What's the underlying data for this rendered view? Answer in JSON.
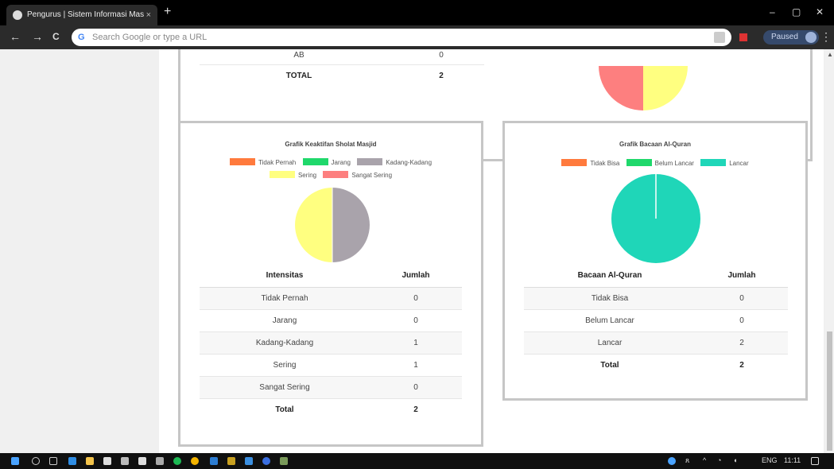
{
  "browser": {
    "tab_title": "Pengurus | Sistem Informasi Mas",
    "tab_close": "×",
    "new_tab": "+",
    "omnibox_placeholder": "Search Google or type a URL",
    "omnibox_g": "G",
    "paused_label": "Paused",
    "back": "←",
    "forward": "→",
    "reload": "C",
    "minimize": "–",
    "maximize": "▢",
    "close": "✕",
    "menu": "⋮"
  },
  "top_table": {
    "rows": [
      {
        "label": "AB",
        "value": "0"
      },
      {
        "label": "TOTAL",
        "value": "2"
      }
    ]
  },
  "sholat": {
    "title": "Grafik Keaktifan Sholat Masjid",
    "legend": [
      {
        "label": "Tidak Pernah",
        "color": "#ff7a3d"
      },
      {
        "label": "Jarang",
        "color": "#1fd86b"
      },
      {
        "label": "Kadang-Kadang",
        "color": "#a9a3ab"
      },
      {
        "label": "Sering",
        "color": "#ffff80"
      },
      {
        "label": "Sangat Sering",
        "color": "#fd7f7f"
      }
    ],
    "col_headers": [
      "Intensitas",
      "Jumlah"
    ],
    "rows": [
      {
        "label": "Tidak Pernah",
        "value": "0"
      },
      {
        "label": "Jarang",
        "value": "0"
      },
      {
        "label": "Kadang-Kadang",
        "value": "1"
      },
      {
        "label": "Sering",
        "value": "1"
      },
      {
        "label": "Sangat Sering",
        "value": "0"
      }
    ],
    "total": {
      "label": "Total",
      "value": "2"
    }
  },
  "quran": {
    "title": "Grafik Bacaan Al-Quran",
    "legend": [
      {
        "label": "Tidak Bisa",
        "color": "#ff7a3d"
      },
      {
        "label": "Belum Lancar",
        "color": "#1fd86b"
      },
      {
        "label": "Lancar",
        "color": "#1fd6b8"
      }
    ],
    "col_headers": [
      "Bacaan Al-Quran",
      "Jumlah"
    ],
    "rows": [
      {
        "label": "Tidak Bisa",
        "value": "0"
      },
      {
        "label": "Belum Lancar",
        "value": "0"
      },
      {
        "label": "Lancar",
        "value": "2"
      }
    ],
    "total": {
      "label": "Total",
      "value": "2"
    }
  },
  "taskbar": {
    "language": "ENG",
    "time": "11:11"
  },
  "colors": {
    "pie_top_red": "#fd7f7f",
    "pie_top_yellow": "#ffff80"
  }
}
